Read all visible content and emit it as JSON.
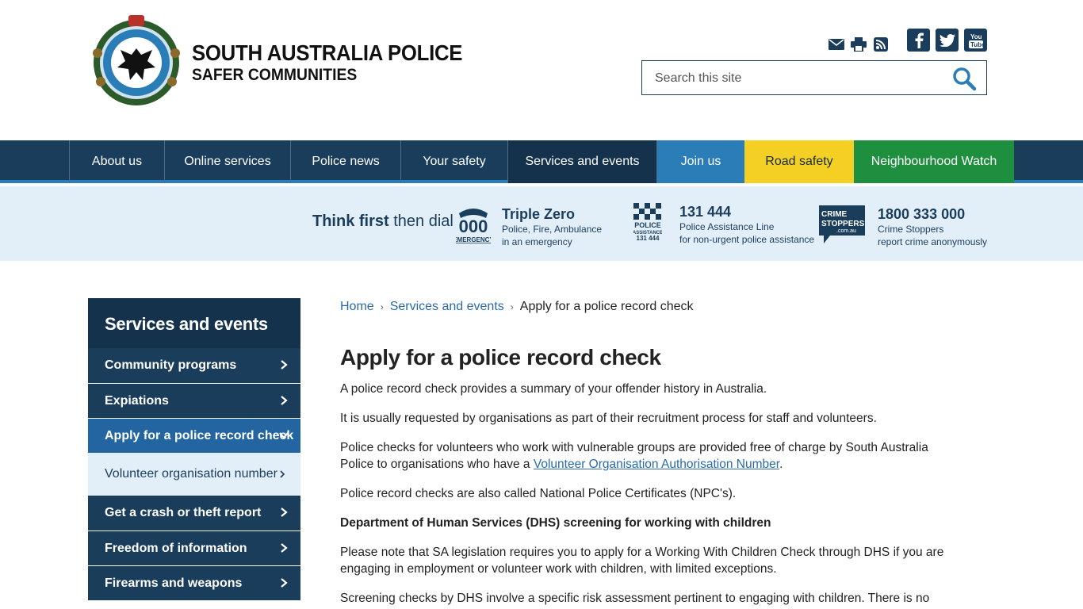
{
  "header": {
    "title": "SOUTH AUSTRALIA POLICE",
    "subtitle": "SAFER COMMUNITIES",
    "logo_icon": "sapol-crest-icon",
    "utility_icons": [
      "email-icon",
      "print-icon",
      "rss-icon"
    ],
    "social_icons": [
      "facebook-icon",
      "twitter-icon",
      "youtube-icon"
    ],
    "search": {
      "placeholder": "Search this site",
      "value": ""
    }
  },
  "nav": {
    "items": [
      {
        "label": "About us"
      },
      {
        "label": "Online services"
      },
      {
        "label": "Police news"
      },
      {
        "label": "Your safety"
      },
      {
        "label": "Services and events"
      },
      {
        "label": "Join us"
      },
      {
        "label": "Road safety"
      },
      {
        "label": "Neighbourhood Watch"
      }
    ],
    "colors": {
      "base": "#1a3d5c",
      "join": "#2b7db8",
      "road": "#f4d025",
      "nw": "#1e8f3e"
    }
  },
  "dialbar": {
    "think_bold": "Think first",
    "think_rest": "then dial",
    "items": [
      {
        "number": "Triple Zero",
        "line1": "Police, Fire, Ambulance",
        "line2": "in an emergency",
        "icon": "triple-zero-phone-icon"
      },
      {
        "number": "131 444",
        "line1": "Police Assistance Line",
        "line2": "for non-urgent police assistance",
        "icon": "police-assistance-icon"
      },
      {
        "number": "1800 333 000",
        "line1": "Crime Stoppers",
        "line2": "report crime anonymously",
        "icon": "crime-stoppers-icon"
      }
    ]
  },
  "sidebar": {
    "title": "Services and events",
    "items": [
      {
        "label": "Community programs"
      },
      {
        "label": "Expiations"
      },
      {
        "label": "Apply for a police record check"
      },
      {
        "label": "Get a crash or theft report"
      },
      {
        "label": "Freedom of information"
      },
      {
        "label": "Firearms and weapons"
      }
    ],
    "sub_item": {
      "label": "Volunteer organisation number"
    }
  },
  "breadcrumb": {
    "home": "Home",
    "section": "Services and events",
    "current": "Apply for a police record check"
  },
  "content": {
    "heading": "Apply for a police record check",
    "p1": "A police record check provides a summary of your offender history in Australia.",
    "p2": "It is usually requested by organisations as part of their recruitment process for staff and volunteers.",
    "p3_before": "Police checks for volunteers who work with vulnerable groups are provided free of charge by South Australia Police to organisations who have a ",
    "p3_link": "Volunteer Organisation Authorisation Number",
    "p3_after": ".",
    "p4": "Police record checks are also called National Police Certificates (NPC's).",
    "h_dhs": "Department of Human Services (DHS) screening for working with children",
    "p5": "Please note that SA legislation requires you to apply for a Working With Children Check through DHS if you are engaging in employment or volunteer work with children, with limited exceptions.",
    "p6": "Screening checks by DHS involve a specific risk assessment pertinent to engaging with children. There is no such risk"
  }
}
